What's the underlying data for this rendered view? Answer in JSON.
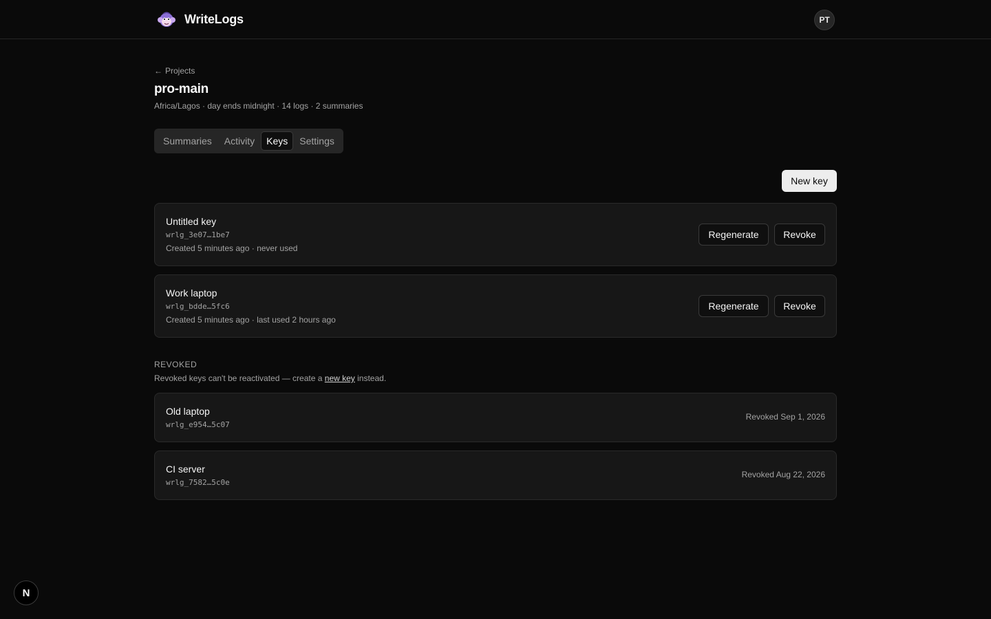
{
  "app": {
    "name": "WriteLogs",
    "user_initials": "PT"
  },
  "nav": {
    "back_label": "Projects"
  },
  "project": {
    "title": "pro-main",
    "meta": "Africa/Lagos · day ends midnight · 14 logs · 2 summaries"
  },
  "tabs": [
    {
      "label": "Summaries",
      "active": false
    },
    {
      "label": "Activity",
      "active": false
    },
    {
      "label": "Keys",
      "active": true
    },
    {
      "label": "Settings",
      "active": false
    }
  ],
  "actions": {
    "new_key_label": "New key",
    "regenerate_label": "Regenerate",
    "revoke_label": "Revoke"
  },
  "active_keys": [
    {
      "name": "Untitled key",
      "id": "wrlg_3e07…1be7",
      "info": "Created 5 minutes ago · never used"
    },
    {
      "name": "Work laptop",
      "id": "wrlg_bdde…5fc6",
      "info": "Created 5 minutes ago · last used 2 hours ago"
    }
  ],
  "revoked": {
    "heading": "REVOKED",
    "note_before": "Revoked keys can't be reactivated — create a ",
    "note_link": "new key",
    "note_after": " instead.",
    "keys": [
      {
        "name": "Old laptop",
        "id": "wrlg_e954…5c07",
        "revoked": "Revoked Sep 1, 2026"
      },
      {
        "name": "CI server",
        "id": "wrlg_7582…5c0e",
        "revoked": "Revoked Aug 22, 2026"
      }
    ]
  },
  "dev_badge": "N"
}
